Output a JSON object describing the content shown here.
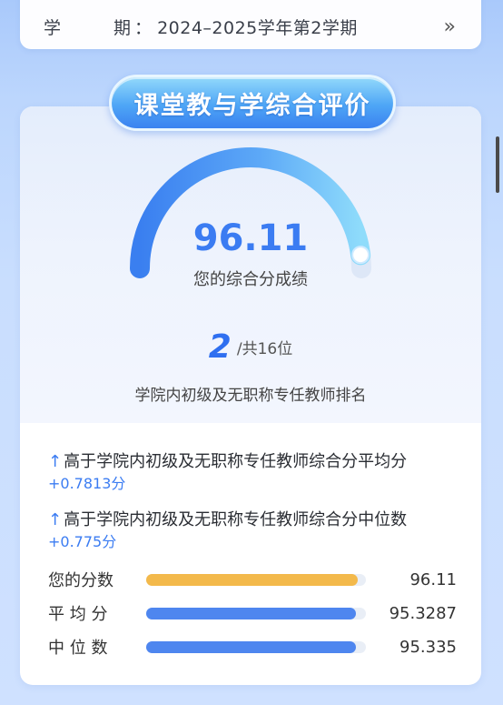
{
  "semester": {
    "label": "学 期",
    "colon": "：",
    "value": "2024–2025学年第2学期",
    "chevron": "»"
  },
  "title": "课堂教与学综合评价",
  "score": {
    "value": "96.11",
    "label": "您的综合分成绩",
    "fraction": 0.9611
  },
  "rank": {
    "number": "2",
    "total": "/共16位",
    "description": "学院内初级及无职称专任教师排名"
  },
  "comparisons": [
    {
      "arrow": "↑",
      "text": "高于学院内初级及无职称专任教师综合分平均分",
      "delta": "+0.7813分"
    },
    {
      "arrow": "↑",
      "text": "高于学院内初级及无职称专任教师综合分中位数",
      "delta": "+0.775分"
    }
  ],
  "bars": [
    {
      "label": "您的分数",
      "value": "96.11",
      "fraction": 0.9611,
      "color": "#f3b94b"
    },
    {
      "label": "平 均 分",
      "value": "95.3287",
      "fraction": 0.953287,
      "color": "#4e86ef"
    },
    {
      "label": "中 位 数",
      "value": "95.335",
      "fraction": 0.95335,
      "color": "#4e86ef"
    }
  ],
  "colors": {
    "accent": "#3b7cf2",
    "gauge_start": "#3a7ff0",
    "gauge_end": "#8fdcfb",
    "score_bar": "#f3b94b",
    "compare_bar": "#4e86ef"
  }
}
